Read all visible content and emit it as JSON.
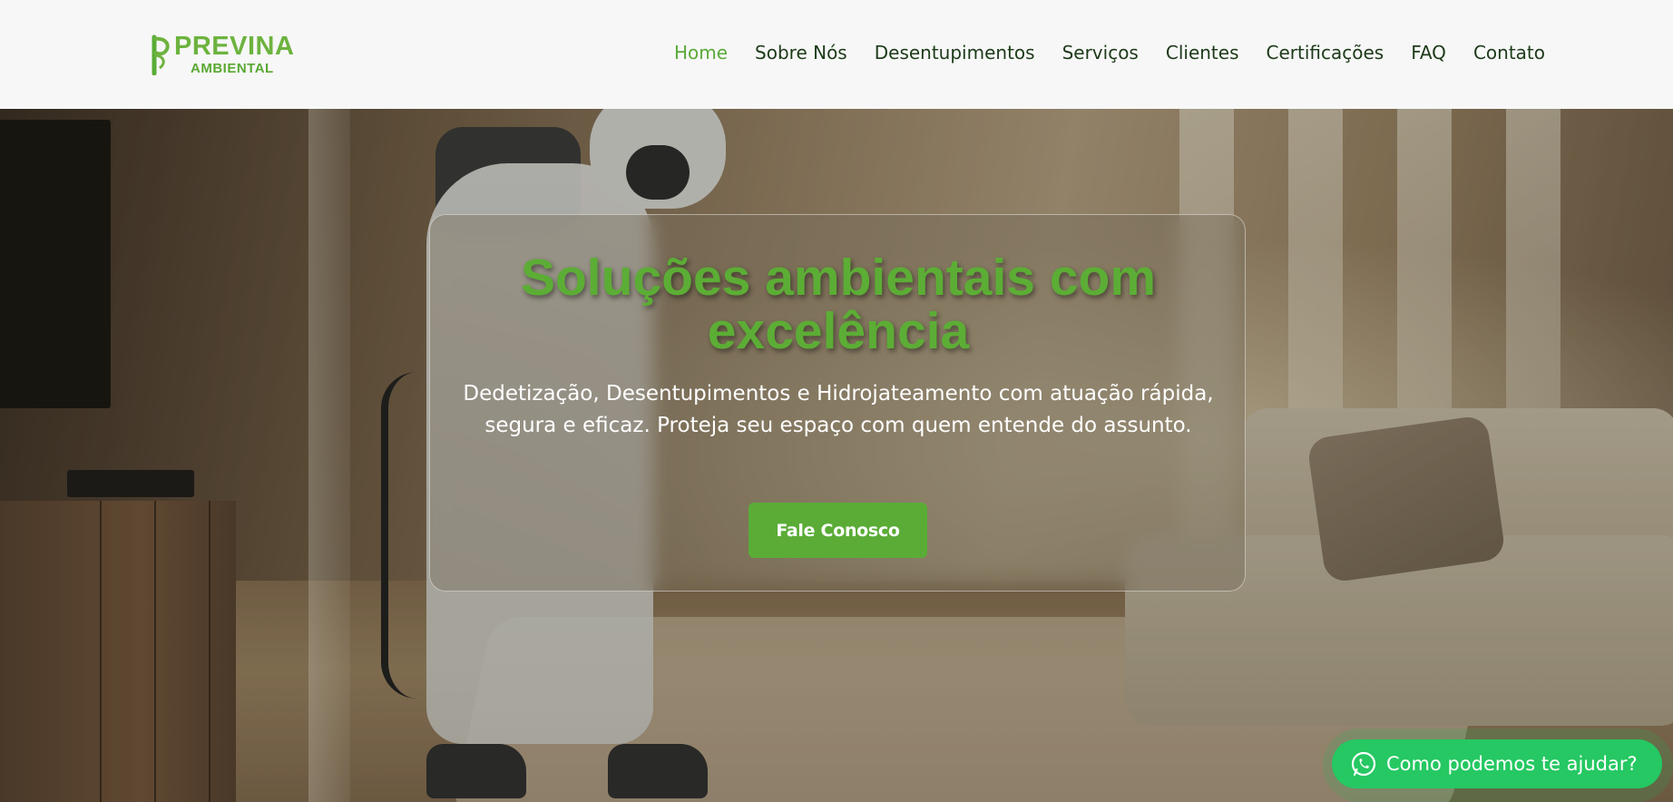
{
  "brand": {
    "name_top": "PREVINA",
    "name_bottom": "AMBIENTAL",
    "logo_icon": "leaf-p-icon",
    "accent_color": "#5aac36"
  },
  "nav": {
    "items": [
      {
        "label": "Home",
        "active": true
      },
      {
        "label": "Sobre Nós",
        "active": false
      },
      {
        "label": "Desentupimentos",
        "active": false
      },
      {
        "label": "Serviços",
        "active": false
      },
      {
        "label": "Clientes",
        "active": false
      },
      {
        "label": "Certificações",
        "active": false
      },
      {
        "label": "FAQ",
        "active": false
      },
      {
        "label": "Contato",
        "active": false
      }
    ]
  },
  "hero": {
    "title": "Soluções ambientais com excelência",
    "subtitle": "Dedetização, Desentupimentos e Hidrojateamento com atuação rápida, segura e eficaz. Proteja seu espaço com quem entende do assunto.",
    "cta_label": "Fale Conosco"
  },
  "whatsapp": {
    "icon": "whatsapp-icon",
    "label": "Como podemos te ajudar?",
    "color": "#25c862"
  }
}
